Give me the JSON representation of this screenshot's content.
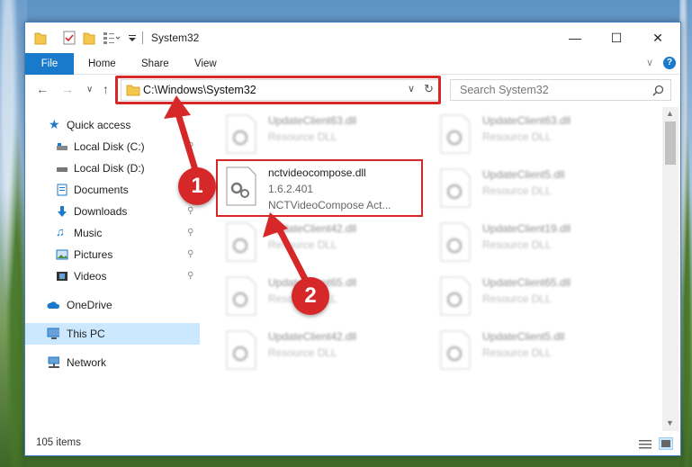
{
  "window": {
    "title": "System32",
    "controls": {
      "minimize": "—",
      "maximize": "☐",
      "close": "✕"
    }
  },
  "ribbon": {
    "tabs": [
      "File",
      "Home",
      "Share",
      "View"
    ]
  },
  "navigation": {
    "address": "C:\\Windows\\System32",
    "search_placeholder": "Search System32"
  },
  "sidebar": {
    "items": [
      {
        "label": "Quick access",
        "icon": "star-icon",
        "pinned": false
      },
      {
        "label": "Local Disk (C:)",
        "icon": "drive-icon",
        "pinned": true
      },
      {
        "label": "Local Disk (D:)",
        "icon": "drive-icon",
        "pinned": false
      },
      {
        "label": "Documents",
        "icon": "documents-icon",
        "pinned": true
      },
      {
        "label": "Downloads",
        "icon": "download-icon",
        "pinned": true
      },
      {
        "label": "Music",
        "icon": "music-icon",
        "pinned": true
      },
      {
        "label": "Pictures",
        "icon": "pictures-icon",
        "pinned": true
      },
      {
        "label": "Videos",
        "icon": "videos-icon",
        "pinned": true
      },
      {
        "label": "OneDrive",
        "icon": "cloud-icon",
        "pinned": false
      },
      {
        "label": "This PC",
        "icon": "computer-icon",
        "pinned": false
      },
      {
        "label": "Network",
        "icon": "network-icon",
        "pinned": false
      }
    ]
  },
  "files": [
    {
      "name": "UpdateClient63.dll",
      "type": "Resource DLL"
    },
    {
      "name": "UpdateClient63.dll",
      "type": "Resource DLL"
    },
    {
      "name": "nctvideocompose.dll",
      "version": "1.6.2.401",
      "description": "NCTVideoCompose Act..."
    },
    {
      "name": "UpdateClient5.dll",
      "type": "Resource DLL"
    },
    {
      "name": "UpdateClient42.dll",
      "type": "Resource DLL"
    },
    {
      "name": "UpdateClient19.dll",
      "type": "Resource DLL"
    },
    {
      "name": "UpdateClient65.dll",
      "type": "Resource DLL"
    },
    {
      "name": "UpdateClient65.dll",
      "type": "Resource DLL"
    },
    {
      "name": "UpdateClient42.dll",
      "type": "Resource DLL"
    },
    {
      "name": "UpdateClient5.dll",
      "type": "Resource DLL"
    }
  ],
  "status": {
    "item_count": "105 items"
  },
  "callouts": {
    "step1": "1",
    "step2": "2"
  },
  "colors": {
    "accent": "#1979ca",
    "highlight": "#d62828",
    "selected": "#cce8ff"
  }
}
